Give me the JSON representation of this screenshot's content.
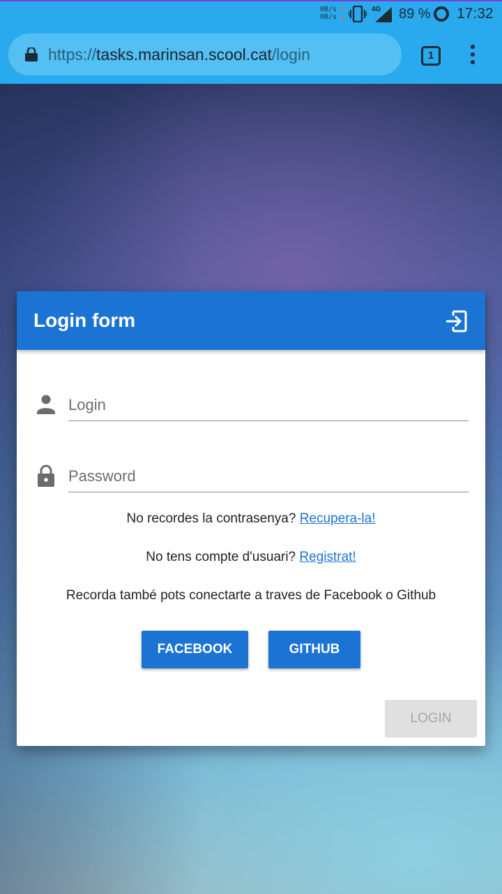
{
  "status_bar": {
    "net_up": "0B/s",
    "net_down": "0B/s",
    "network_type": "4G",
    "battery": "89 %",
    "time": "17:32"
  },
  "browser": {
    "url_scheme": "https://",
    "url_host": "tasks.marinsan.scool.cat",
    "url_path": "/login",
    "tab_count": "1"
  },
  "login_card": {
    "title": "Login form",
    "login_placeholder": "Login",
    "password_placeholder": "Password",
    "forgot_text": "No recordes la contrasenya?",
    "forgot_link": "Recupera-la!",
    "register_text": "No tens compte d'usuari?",
    "register_link": "Registrat!",
    "social_text": "Recorda també pots conectarte a traves de Facebook o Github",
    "facebook_label": "FACEBOOK",
    "github_label": "GITHUB",
    "login_label": "LOGIN"
  },
  "colors": {
    "primary": "#1b73d3",
    "status_bar": "#2aaaee",
    "disabled_button": "#e0e0e0"
  }
}
